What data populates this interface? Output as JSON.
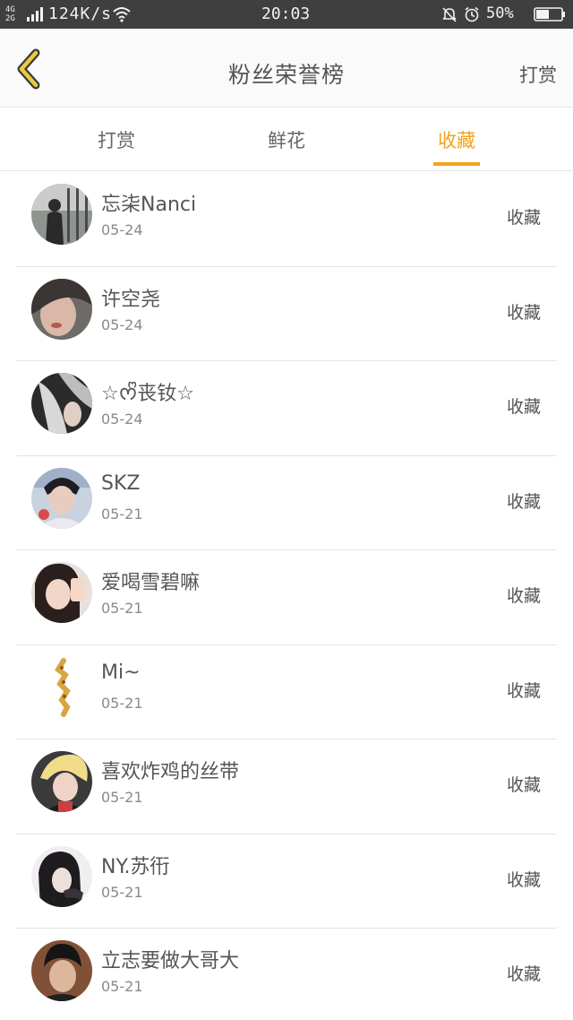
{
  "status_bar": {
    "network_top": "4G",
    "network_bottom": "2G",
    "speed": "124K/s",
    "time": "20:03",
    "battery": "50%",
    "icons": [
      "signal-icon",
      "wifi-icon",
      "bell-muted-icon",
      "alarm-icon",
      "battery-icon"
    ]
  },
  "header": {
    "back_icon": "chevron-left-icon",
    "title": "粉丝荣誉榜",
    "action": "打赏"
  },
  "tabs": [
    {
      "label": "打赏",
      "active": false
    },
    {
      "label": "鲜花",
      "active": false
    },
    {
      "label": "收藏",
      "active": true
    }
  ],
  "entries": [
    {
      "name": "忘㭍Nanci",
      "date": "05-24",
      "type": "收藏"
    },
    {
      "name": "许空尧",
      "date": "05-24",
      "type": "收藏"
    },
    {
      "name": "☆ᰔᩚ丧钕☆",
      "date": "05-24",
      "type": "收藏"
    },
    {
      "name": "SKZ",
      "date": "05-21",
      "type": "收藏"
    },
    {
      "name": "爱喝雪碧嘛",
      "date": "05-21",
      "type": "收藏"
    },
    {
      "name": "Mi~",
      "date": "05-21",
      "type": "收藏"
    },
    {
      "name": "喜欢炸鸡的丝带",
      "date": "05-21",
      "type": "收藏"
    },
    {
      "name": "NY.苏衎",
      "date": "05-21",
      "type": "收藏"
    },
    {
      "name": "立志要做大哥大",
      "date": "05-21",
      "type": "收藏"
    }
  ],
  "colors": {
    "accent": "#f3a21b",
    "status_bar": "#3f3f3f",
    "back_icon": "#e8cc3c"
  }
}
